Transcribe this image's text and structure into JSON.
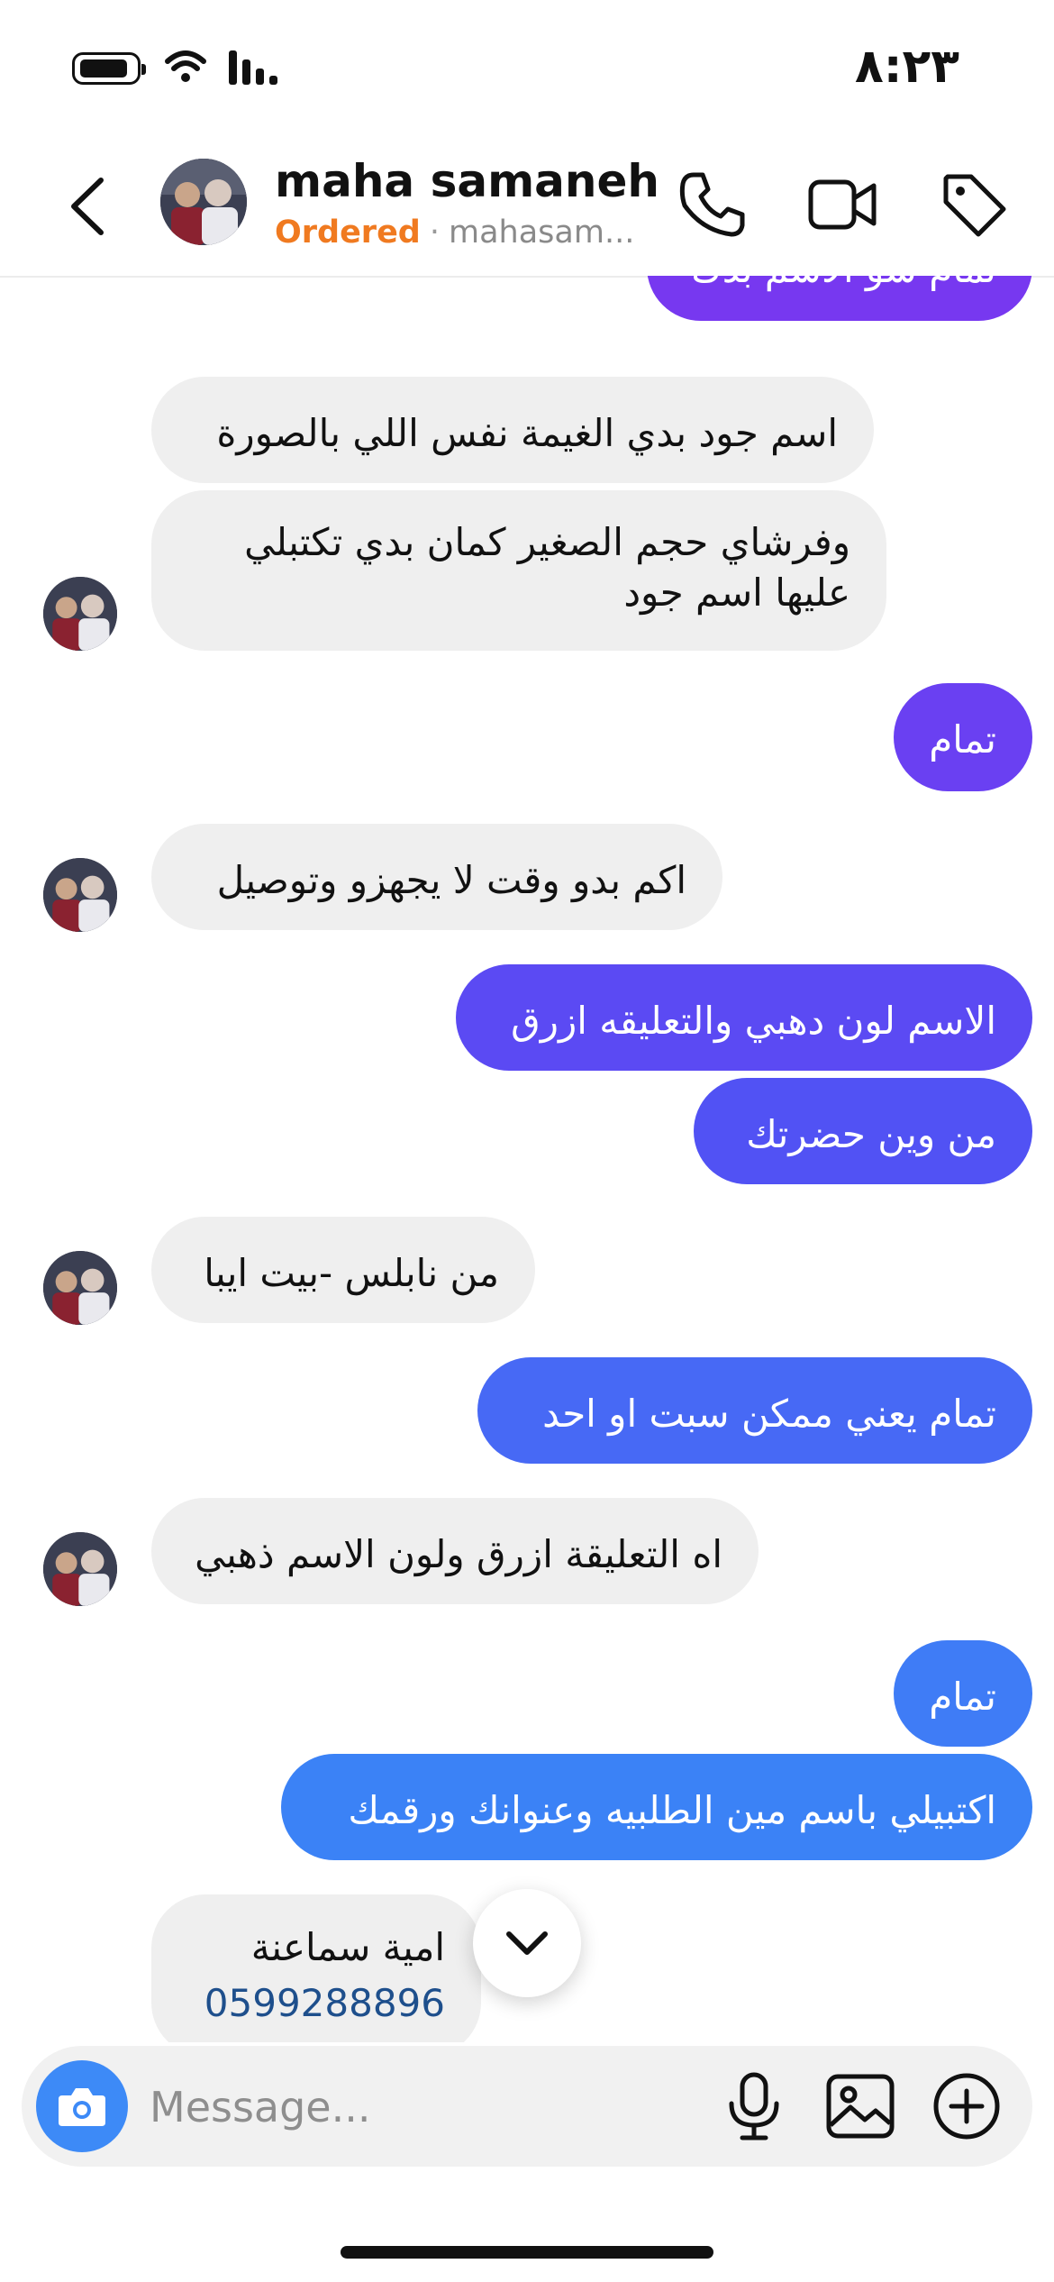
{
  "status_bar": {
    "time": "٨:٢٣"
  },
  "header": {
    "name": "maha samaneh",
    "status": "Ordered",
    "handle": "mahasam..."
  },
  "messages": [
    {
      "side": "out",
      "text": "تمام شو الاسم بدك"
    },
    {
      "side": "in",
      "text": "اسم جود بدي الغيمة نفس اللي بالصورة"
    },
    {
      "side": "in",
      "text": "وفرشاي حجم الصغير  كمان بدي تكتبلي\nعليها اسم جود"
    },
    {
      "side": "out",
      "text": "تمام"
    },
    {
      "side": "in",
      "text": "اكم بدو وقت لا يجهزو وتوصيل"
    },
    {
      "side": "out",
      "text": "الاسم لون دهبي والتعليقه ازرق"
    },
    {
      "side": "out",
      "text": "من وين حضرتك"
    },
    {
      "side": "in",
      "text": "من نابلس -بيت ايبا"
    },
    {
      "side": "out",
      "text": "تمام يعني ممكن سبت او احد"
    },
    {
      "side": "in",
      "text": "اه التعليقة ازرق ولون الاسم ذهبي"
    },
    {
      "side": "out",
      "text": "تمام"
    },
    {
      "side": "out",
      "text": "اكتبيلي باسم مين الطلبيه وعنوانك ورقمك"
    },
    {
      "side": "in",
      "text": "امية سماعنة",
      "phone": "0599288896"
    }
  ],
  "composer": {
    "placeholder": "Message..."
  },
  "colors": {
    "accent_orange": "#f07a20",
    "outgoing_top": "#7a3cf2",
    "outgoing_bottom": "#3b82f6",
    "incoming_bg": "#efefef",
    "camera_button": "#3d8af7"
  },
  "icons": [
    "battery-icon",
    "wifi-icon",
    "signal-icon",
    "back-icon",
    "phone-icon",
    "video-icon",
    "tag-icon",
    "camera-icon",
    "mic-icon",
    "image-icon",
    "plus-icon",
    "chevron-down-icon"
  ]
}
